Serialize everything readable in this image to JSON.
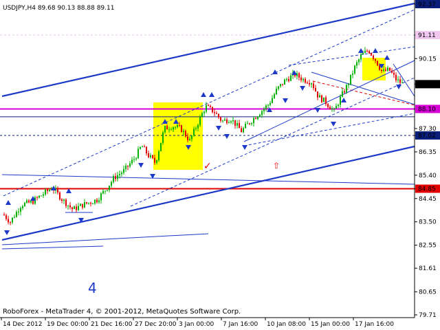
{
  "chart_data": {
    "type": "candlestick",
    "symbol_info": "USDJPY,H4  89.68 90.13 88.88 89.11",
    "footer": "RoboForex - MetaTrader 4, © 2001-2012, MetaQuotes Software Corp.",
    "wave_label": "4",
    "ylim": [
      79.2,
      92.9
    ],
    "y_ticks": [
      "92.37",
      "91.11",
      "90.15",
      "89.11",
      "88.10",
      "87.30",
      "87.02",
      "86.35",
      "85.40",
      "84.85",
      "84.45",
      "83.50",
      "82.55",
      "81.61",
      "80.65",
      "79.71"
    ],
    "x_ticks": [
      "14 Dec 2012",
      "19 Dec 00:00",
      "21 Dec 16:00",
      "27 Dec 20:00",
      "3 Jan 00:00",
      "7 Jan 16:00",
      "10 Jan 08:00",
      "15 Jan 00:00",
      "17 Jan 16:00"
    ],
    "price_badges": [
      {
        "label": "92.37",
        "price": 92.37,
        "color": "#0a1e7a"
      },
      {
        "label": "91.11",
        "price": 91.11,
        "color": "#f0c8f0"
      },
      {
        "label": "89.11",
        "price": 89.11,
        "color": "#000000"
      },
      {
        "label": "88.10",
        "price": 88.1,
        "color": "#d400d4"
      },
      {
        "label": "87.02",
        "price": 87.02,
        "color": "#0a1e7a"
      },
      {
        "label": "84.85",
        "price": 84.85,
        "color": "#e00000"
      }
    ],
    "levels": [
      {
        "price": 84.85,
        "color": "#e00000",
        "style": "solid"
      },
      {
        "price": 88.1,
        "color": "#d400d4",
        "style": "solid"
      },
      {
        "price": 87.78,
        "color": "#0a1e7a",
        "style": "solid"
      },
      {
        "price": 87.02,
        "color": "#0a1e7a",
        "style": "dash"
      },
      {
        "price": 91.11,
        "color": "#e8c0e8",
        "style": "dash"
      }
    ],
    "colors": {
      "bull": "#00b000",
      "bear": "#e00000",
      "channel": "#1c39c8",
      "target_box": "#ffff00",
      "fractal": "#1c39c8"
    }
  }
}
